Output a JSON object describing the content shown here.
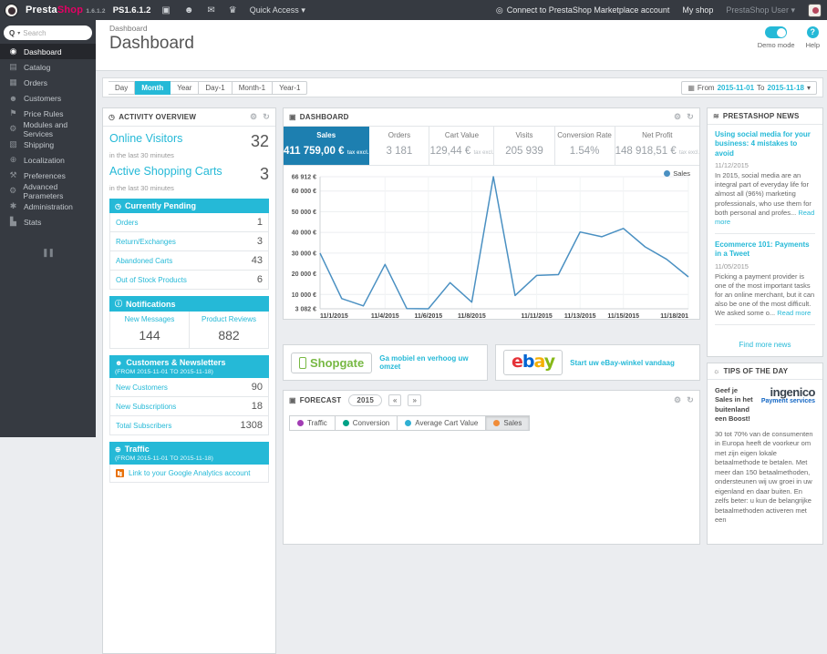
{
  "colors": {
    "primary": "#25b9d7",
    "kpi_active": "#1d7fb0",
    "topbar": "#363a41",
    "chart_line": "#4a90c2",
    "ga_icon": "#e8710a"
  },
  "icons": {
    "caret": "▾",
    "gear": "⚙",
    "refresh": "↻",
    "cart": "▣",
    "person": "☻",
    "envelope": "✉",
    "trophy": "♛",
    "marketplace": "◎",
    "clock": "◷",
    "news": "≋",
    "bulb": "☼",
    "info": "ⓘ",
    "globe": "⊕",
    "calendar": "▦",
    "search": "Q",
    "prev": "«",
    "next": "»",
    "collapse": "❚❚",
    "help": "?"
  },
  "topbar": {
    "brand_a": "Presta",
    "brand_b": "Shop",
    "version_small": "1.6.1.2",
    "version_label": "PS1.6.1.2",
    "quick_access": "Quick Access",
    "marketplace_link": "Connect to PrestaShop Marketplace account",
    "my_shop": "My shop",
    "user": "PrestaShop User"
  },
  "sidebar": {
    "search_placeholder": "Search",
    "items": [
      {
        "label": "Dashboard",
        "icon": "dashboard-icon",
        "glyph": "◉",
        "active": true
      },
      {
        "label": "Catalog",
        "icon": "catalog-icon",
        "glyph": "▤"
      },
      {
        "label": "Orders",
        "icon": "orders-icon",
        "glyph": "▦"
      },
      {
        "label": "Customers",
        "icon": "customers-icon",
        "glyph": "☻"
      },
      {
        "label": "Price Rules",
        "icon": "price-rules-icon",
        "glyph": "⚑"
      },
      {
        "label": "Modules and Services",
        "icon": "modules-icon",
        "glyph": "⚙"
      },
      {
        "label": "Shipping",
        "icon": "shipping-icon",
        "glyph": "▧"
      },
      {
        "label": "Localization",
        "icon": "localization-icon",
        "glyph": "⊕"
      },
      {
        "label": "Preferences",
        "icon": "preferences-icon",
        "glyph": "⚒"
      },
      {
        "label": "Advanced Parameters",
        "icon": "advanced-parameters-icon",
        "glyph": "⚙"
      },
      {
        "label": "Administration",
        "icon": "administration-icon",
        "glyph": "✱"
      },
      {
        "label": "Stats",
        "icon": "stats-icon",
        "glyph": "▙"
      }
    ]
  },
  "header": {
    "breadcrumb": "Dashboard",
    "title": "Dashboard",
    "demo_mode_label": "Demo mode",
    "help_label": "Help"
  },
  "filters": {
    "buttons": [
      {
        "label": "Day"
      },
      {
        "label": "Month",
        "active": true
      },
      {
        "label": "Year"
      },
      {
        "label": "Day-1"
      },
      {
        "label": "Month-1"
      },
      {
        "label": "Year-1"
      }
    ],
    "date_range": {
      "from_label": "From",
      "from": "2015-11-01",
      "to_label": "To",
      "to": "2015-11-18"
    }
  },
  "activity": {
    "title": "ACTIVITY OVERVIEW",
    "online_visitors": {
      "label": "Online Visitors",
      "value": "32",
      "sub": "in the last 30 minutes"
    },
    "active_carts": {
      "label": "Active Shopping Carts",
      "value": "3",
      "sub": "in the last 30 minutes"
    },
    "pending": {
      "title": "Currently Pending",
      "rows": [
        {
          "label": "Orders",
          "value": "1"
        },
        {
          "label": "Return/Exchanges",
          "value": "3"
        },
        {
          "label": "Abandoned Carts",
          "value": "43"
        },
        {
          "label": "Out of Stock Products",
          "value": "6"
        }
      ]
    },
    "notifications": {
      "title": "Notifications",
      "cols": [
        {
          "label": "New Messages",
          "value": "144"
        },
        {
          "label": "Product Reviews",
          "value": "882"
        }
      ]
    },
    "customers": {
      "title": "Customers & Newsletters",
      "subtitle": "(FROM 2015-11-01 TO 2015-11-18)",
      "rows": [
        {
          "label": "New Customers",
          "value": "90"
        },
        {
          "label": "New Subscriptions",
          "value": "18"
        },
        {
          "label": "Total Subscribers",
          "value": "1308"
        }
      ]
    },
    "traffic": {
      "title": "Traffic",
      "subtitle": "(FROM 2015-11-01 TO 2015-11-18)",
      "link": "Link to your Google Analytics account"
    }
  },
  "dashboard_panel": {
    "title": "DASHBOARD",
    "kpis": [
      {
        "label": "Sales",
        "value": "411 759,00 €",
        "suffix": "tax excl.",
        "active": true
      },
      {
        "label": "Orders",
        "value": "3 181",
        "suffix": ""
      },
      {
        "label": "Cart Value",
        "value": "129,44 €",
        "suffix": "tax excl."
      },
      {
        "label": "Visits",
        "value": "205 939",
        "suffix": ""
      },
      {
        "label": "Conversion Rate",
        "value": "1.54%",
        "suffix": ""
      },
      {
        "label": "Net Profit",
        "value": "148 918,51 €",
        "suffix": "tax excl."
      }
    ]
  },
  "chart_data": {
    "type": "line",
    "x": [
      "11/1/2015",
      "11/2/2015",
      "11/3/2015",
      "11/4/2015",
      "11/5/2015",
      "11/6/2015",
      "11/7/2015",
      "11/8/2015",
      "11/9/2015",
      "11/10/2015",
      "11/11/2015",
      "11/12/2015",
      "11/13/2015",
      "11/14/2015",
      "11/15/2015",
      "11/16/2015",
      "11/17/2015",
      "11/18/2015"
    ],
    "series": [
      {
        "name": "Sales",
        "color": "#4a90c2",
        "values": [
          30000,
          8000,
          4500,
          24500,
          3200,
          3082,
          15700,
          6300,
          66912,
          9500,
          19200,
          19600,
          40200,
          37900,
          41900,
          33000,
          27000,
          18500
        ]
      }
    ],
    "ylim": [
      3082,
      66912
    ],
    "yticks": [
      {
        "value": 66912,
        "label": "66 912 €"
      },
      {
        "value": 60000,
        "label": "60 000 €"
      },
      {
        "value": 50000,
        "label": "50 000 €"
      },
      {
        "value": 40000,
        "label": "40 000 €"
      },
      {
        "value": 30000,
        "label": "30 000 €"
      },
      {
        "value": 20000,
        "label": "20 000 €"
      },
      {
        "value": 10000,
        "label": "10 000 €"
      },
      {
        "value": 3082,
        "label": "3 082 €"
      }
    ],
    "xticks": [
      {
        "index": 0,
        "label": "11/1/2015"
      },
      {
        "index": 3,
        "label": "11/4/2015"
      },
      {
        "index": 5,
        "label": "11/6/2015"
      },
      {
        "index": 7,
        "label": "11/8/2015"
      },
      {
        "index": 10,
        "label": "11/11/2015"
      },
      {
        "index": 12,
        "label": "11/13/2015"
      },
      {
        "index": 14,
        "label": "11/15/2015"
      },
      {
        "index": 17,
        "label": "11/18/201"
      }
    ],
    "legend": {
      "position": "top-right",
      "entries": [
        "Sales"
      ]
    },
    "grid": true
  },
  "modules": {
    "shopgate": {
      "logo": "Shopgate",
      "link": "Ga mobiel en verhoog uw omzet"
    },
    "ebay": {
      "letters": [
        {
          "ch": "e",
          "color": "#e53238"
        },
        {
          "ch": "b",
          "color": "#0064d2"
        },
        {
          "ch": "a",
          "color": "#f5af02"
        },
        {
          "ch": "y",
          "color": "#86b817"
        }
      ],
      "link": "Start uw eBay-winkel vandaag"
    }
  },
  "forecast": {
    "title": "FORECAST",
    "year": "2015",
    "legend": [
      {
        "label": "Traffic",
        "color": "#a23db4"
      },
      {
        "label": "Conversion",
        "color": "#00a186"
      },
      {
        "label": "Average Cart Value",
        "color": "#30b0d3"
      },
      {
        "label": "Sales",
        "color": "#f08c38",
        "active": true
      }
    ]
  },
  "news": {
    "title": "PRESTASHOP NEWS",
    "items": [
      {
        "title": "Using social media for your business: 4 mistakes to avoid",
        "date": "11/12/2015",
        "excerpt": "In 2015, social media are an integral part of everyday life for almost all (96%) marketing professionals, who use them for both personal and profes...",
        "read_more": "Read more"
      },
      {
        "title": "Ecommerce 101: Payments in a Tweet",
        "date": "11/05/2015",
        "excerpt": "Picking a payment provider is one of the most important tasks for an online merchant, but it can also be one of the most difficult. We asked some o...",
        "read_more": "Read more"
      }
    ],
    "footer_link": "Find more news"
  },
  "tips": {
    "title": "TIPS OF THE DAY",
    "headline": "Geef je Sales in het buitenland een Boost!",
    "logo_main": "ingenico",
    "logo_sub": "Payment services",
    "body": "30 tot 70% van de consumenten in Europa heeft de voorkeur om met zijn eigen lokale betaalmethode te betalen. Met meer dan 150 betaalmethoden, ondersteunen wij uw groei in uw eigenland en daar buiten. En zelfs beter: u kun de belangrijke betaalmethoden activeren met een"
  }
}
